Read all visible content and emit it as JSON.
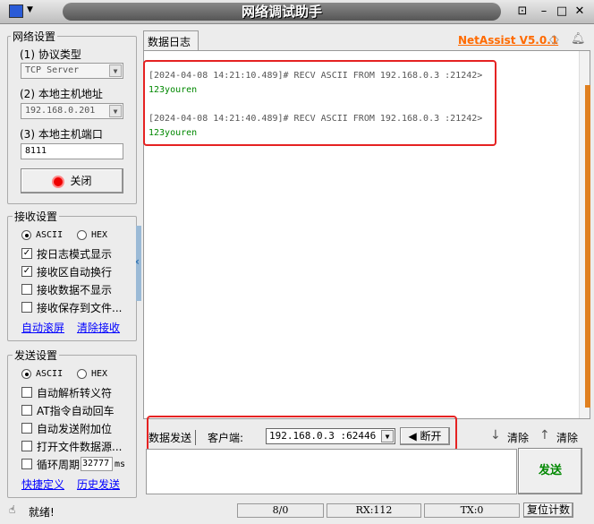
{
  "window": {
    "title": "网络调试助手",
    "brand": "NetAssist V5.0.1"
  },
  "network": {
    "title": "网络设置",
    "protocol_label": "(1) 协议类型",
    "protocol_value": "TCP Server",
    "host_label": "(2) 本地主机地址",
    "host_value": "192.168.0.201",
    "port_label": "(3) 本地主机端口",
    "port_value": "8111",
    "close_button": "关闭"
  },
  "receive": {
    "title": "接收设置",
    "ascii": "ASCII",
    "hex": "HEX",
    "options": [
      {
        "label": "按日志模式显示",
        "checked": true
      },
      {
        "label": "接收区自动换行",
        "checked": true
      },
      {
        "label": "接收数据不显示",
        "checked": false
      },
      {
        "label": "接收保存到文件...",
        "checked": false
      }
    ],
    "auto_scroll": "自动滚屏",
    "clear_receive": "清除接收"
  },
  "send": {
    "title": "发送设置",
    "ascii": "ASCII",
    "hex": "HEX",
    "options": [
      {
        "label": "自动解析转义符",
        "checked": false
      },
      {
        "label": "AT指令自动回车",
        "checked": false
      },
      {
        "label": "自动发送附加位",
        "checked": false
      },
      {
        "label": "打开文件数据源...",
        "checked": false
      }
    ],
    "loop_label": "循环周期",
    "loop_value": "32777",
    "loop_unit": "ms",
    "shortcuts": "快捷定义",
    "history": "历史发送"
  },
  "log": {
    "tab": "数据日志",
    "entries": [
      {
        "header": "[2024-04-08 14:21:10.489]# RECV ASCII FROM 192.168.0.3 :21242>",
        "body": "123youren"
      },
      {
        "header": "[2024-04-08 14:21:40.489]# RECV ASCII FROM 192.168.0.3 :21242>",
        "body": "123youren"
      }
    ]
  },
  "sendbar": {
    "tab": "数据发送",
    "client_label": "客户端:",
    "client_value": "192.168.0.3 :62446",
    "disconnect": "断开",
    "clear1": "清除",
    "clear2": "清除",
    "send_button": "发送"
  },
  "status": {
    "text": "就绪!",
    "count": "8/0",
    "rx": "RX:112",
    "tx": "TX:0",
    "reset": "复位计数"
  }
}
